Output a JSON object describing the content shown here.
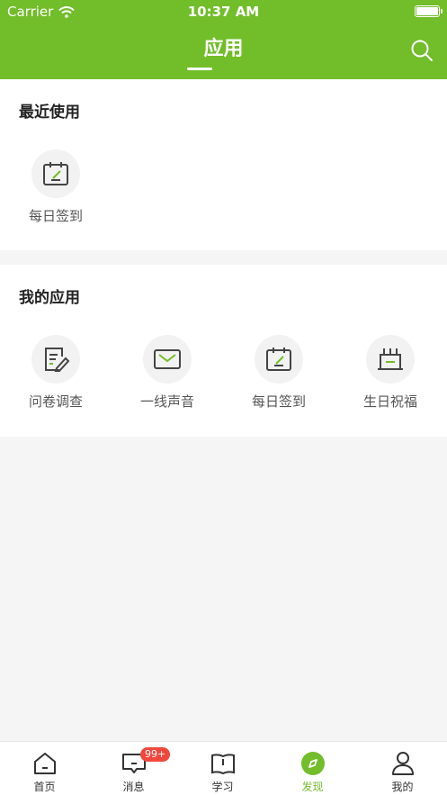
{
  "status_bar": {
    "carrier": "Carrier",
    "time": "10:37 AM"
  },
  "header": {
    "title": "应用"
  },
  "recent": {
    "title": "最近使用",
    "apps": [
      {
        "label": "每日签到",
        "icon": "calendar-check-icon"
      }
    ]
  },
  "mine": {
    "title": "我的应用",
    "apps": [
      {
        "label": "问卷调查",
        "icon": "survey-icon"
      },
      {
        "label": "一线声音",
        "icon": "mail-icon"
      },
      {
        "label": "每日签到",
        "icon": "calendar-check-icon"
      },
      {
        "label": "生日祝福",
        "icon": "cake-icon"
      }
    ]
  },
  "tabbar": {
    "tabs": [
      {
        "label": "首页",
        "icon": "home-icon"
      },
      {
        "label": "消息",
        "icon": "message-icon",
        "badge": "99+"
      },
      {
        "label": "学习",
        "icon": "book-icon"
      },
      {
        "label": "发现",
        "icon": "compass-icon",
        "active": true
      },
      {
        "label": "我的",
        "icon": "profile-icon"
      }
    ]
  },
  "colors": {
    "brand": "#72bd2a",
    "badge": "#f0473c"
  }
}
